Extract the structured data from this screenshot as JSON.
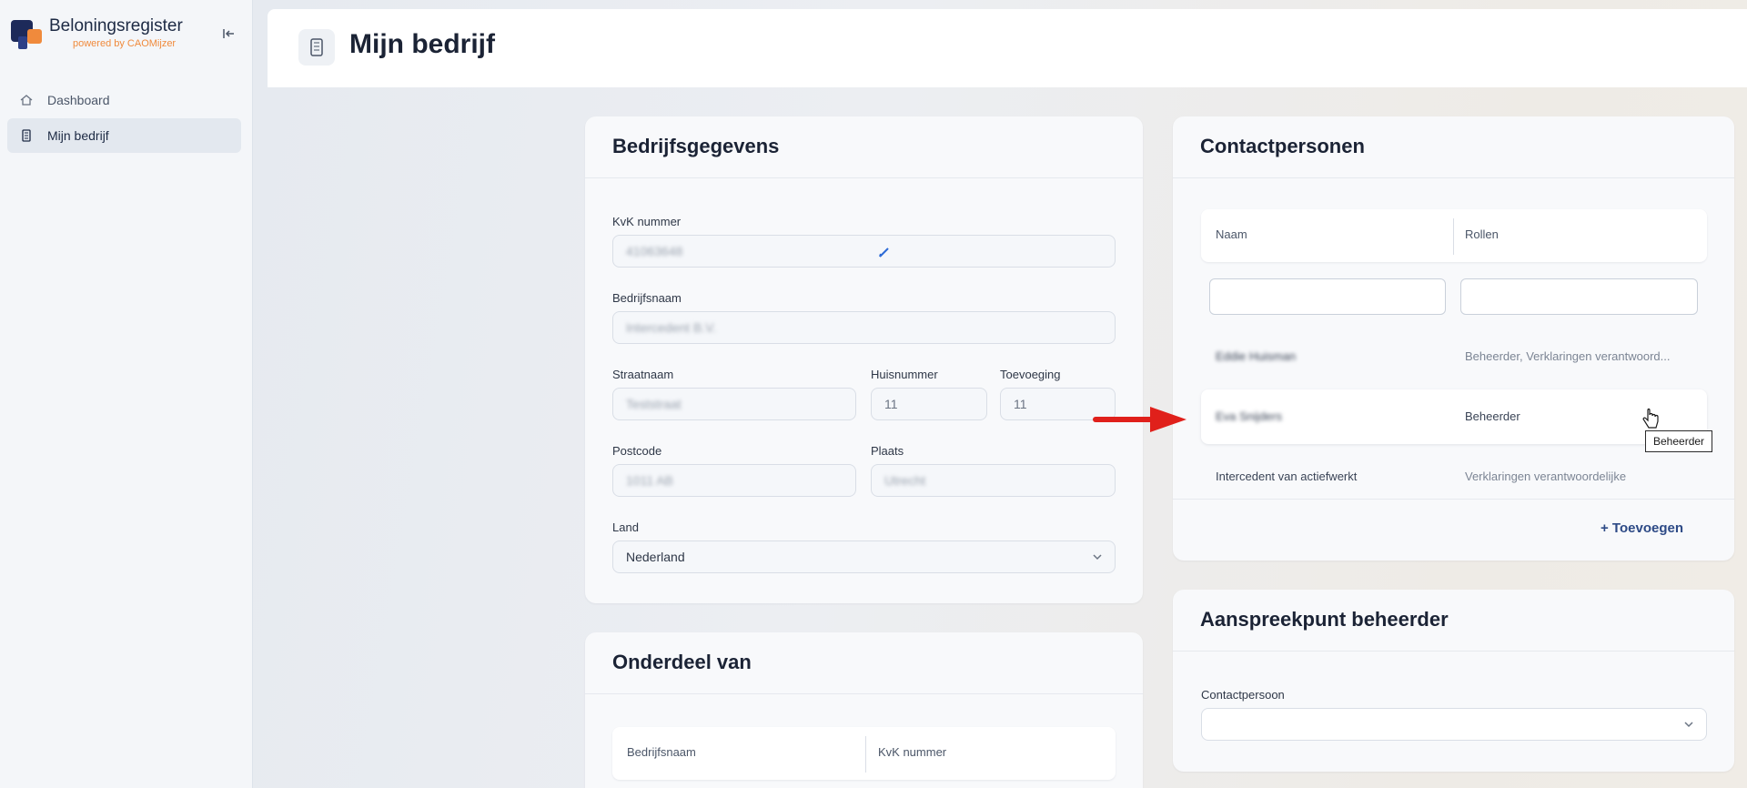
{
  "app": {
    "title": "Beloningsregister",
    "subtitle": "powered by CAOMijzer"
  },
  "sidebar": {
    "items": [
      {
        "label": "Dashboard",
        "icon": "home-icon",
        "active": false
      },
      {
        "label": "Mijn bedrijf",
        "icon": "building-icon",
        "active": true
      }
    ]
  },
  "header": {
    "title": "Mijn bedrijf"
  },
  "company_card": {
    "title": "Bedrijfsgegevens",
    "fields": {
      "kvk": {
        "label": "KvK nummer",
        "value": "41063648"
      },
      "name": {
        "label": "Bedrijfsnaam",
        "value": "Intercedent B.V."
      },
      "street": {
        "label": "Straatnaam",
        "value": "Teststraat"
      },
      "house_number": {
        "label": "Huisnummer",
        "value": "11"
      },
      "addition": {
        "label": "Toevoeging",
        "value": "11"
      },
      "postcode": {
        "label": "Postcode",
        "value": "1011 AB"
      },
      "city": {
        "label": "Plaats",
        "value": "Utrecht"
      },
      "country": {
        "label": "Land",
        "value": "Nederland"
      }
    }
  },
  "parent_card": {
    "title": "Onderdeel van",
    "columns": [
      "Bedrijfsnaam",
      "KvK nummer"
    ]
  },
  "contacts_card": {
    "title": "Contactpersonen",
    "columns": [
      "Naam",
      "Rollen"
    ],
    "rows": [
      {
        "name": "Eddie Huisman",
        "roles": "Beheerder, Verklaringen verantwoord...",
        "blurred": true
      },
      {
        "name": "Eva Snijders",
        "roles": "Beheerder",
        "blurred": true,
        "hover": true
      },
      {
        "name": "Intercedent van actiefwerkt",
        "roles": "Verklaringen verantwoordelijke",
        "blurred": false
      }
    ],
    "add_label": "+ Toevoegen",
    "tooltip": "Beheerder"
  },
  "admin_card": {
    "title": "Aanspreekpunt beheerder",
    "field_label": "Contactpersoon",
    "field_value": ""
  },
  "colors": {
    "accent": "#2d4a86",
    "brand_orange": "#f08a3c",
    "brand_navy": "#1d2a5a",
    "arrow": "#e0201b"
  }
}
